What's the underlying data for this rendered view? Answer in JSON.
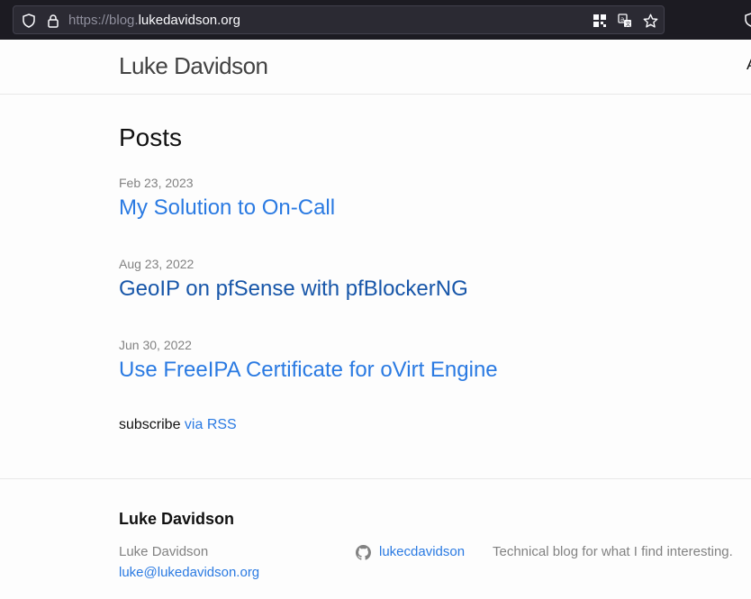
{
  "browser": {
    "url_scheme": "https://blog.",
    "url_domain": "lukedavidson.org",
    "icons": [
      "shield-icon",
      "lock-icon",
      "qr-code-icon",
      "translate-icon",
      "bookmark-star-icon",
      "shield-icon"
    ]
  },
  "header": {
    "site_title": "Luke Davidson",
    "nav_partial": "A"
  },
  "main": {
    "heading": "Posts",
    "posts": [
      {
        "date": "Feb 23, 2023",
        "title": "My Solution to On-Call"
      },
      {
        "date": "Aug 23, 2022",
        "title": "GeoIP on pfSense with pfBlockerNG"
      },
      {
        "date": "Jun 30, 2022",
        "title": "Use FreeIPA Certificate for oVirt Engine"
      }
    ],
    "subscribe_text": "subscribe ",
    "subscribe_link": "via RSS"
  },
  "footer": {
    "heading": "Luke Davidson",
    "name": "Luke Davidson",
    "email": "luke@lukedavidson.org",
    "github_username": "lukecdavidson",
    "description": "Technical blog for what I find interesting."
  },
  "colors": {
    "link": "#2a7ae2",
    "visited_link": "#1756a9",
    "meta_grey": "#828282",
    "chrome_bg": "#1c1b22"
  }
}
